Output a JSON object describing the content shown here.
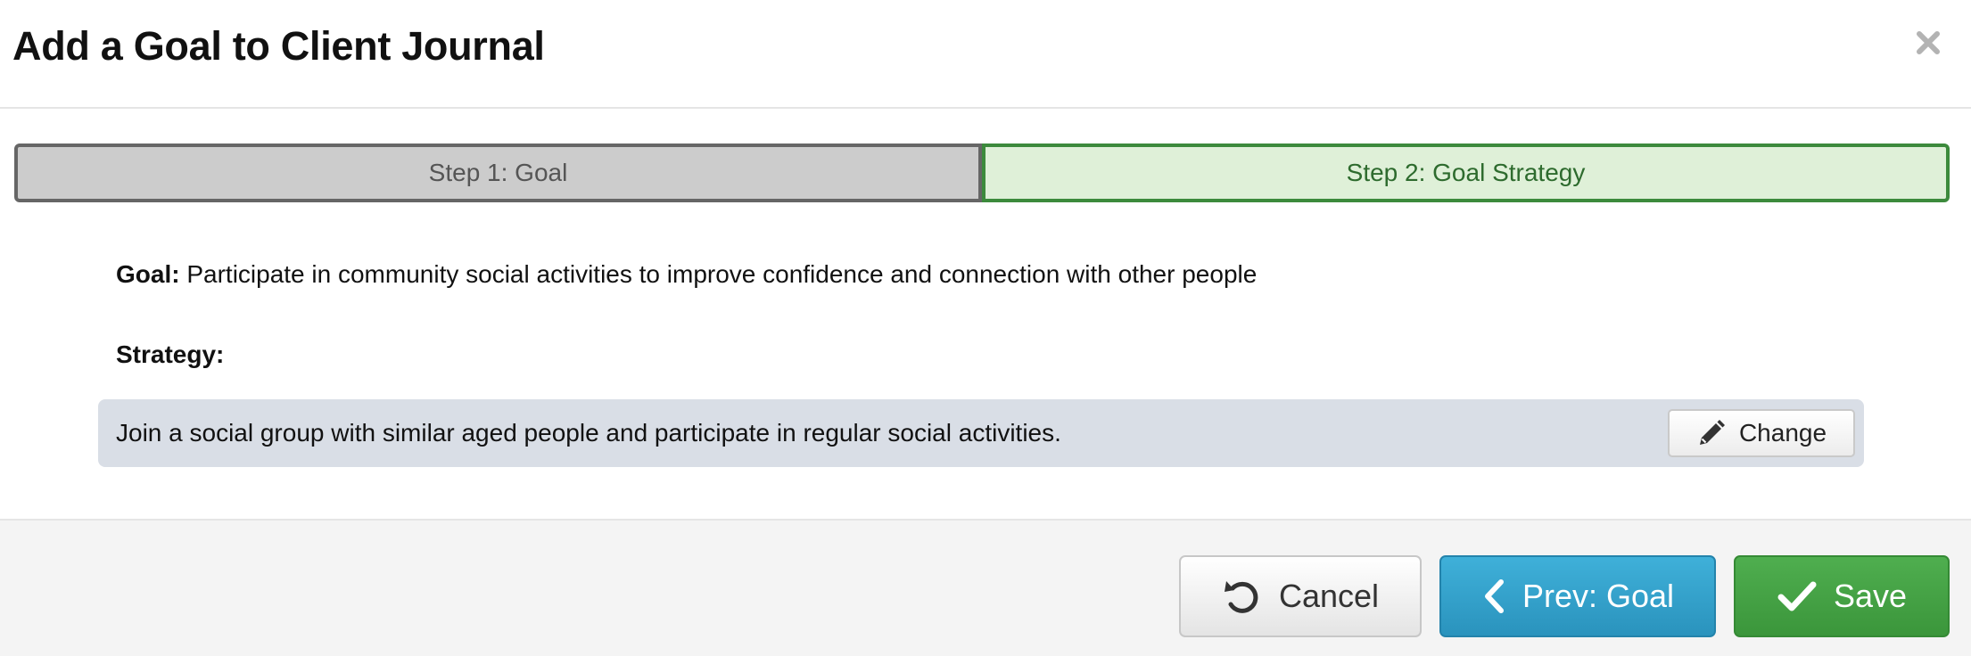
{
  "modal": {
    "title": "Add a Goal to Client Journal",
    "close_icon": "close-icon"
  },
  "steps": [
    {
      "label": "Step 1: Goal",
      "state": "completed",
      "color": "#cccccc"
    },
    {
      "label": "Step 2: Goal Strategy",
      "state": "active",
      "color": "#dff0d8"
    }
  ],
  "goal": {
    "label": "Goal:",
    "text": "Participate in community social activities to improve confidence and connection with other people"
  },
  "strategy": {
    "label": "Strategy:",
    "text": "Join a social group with similar aged people and participate in regular social activities.",
    "change_label": "Change",
    "change_icon": "pencil-icon"
  },
  "footer": {
    "cancel_label": "Cancel",
    "cancel_icon": "undo-icon",
    "prev_label": "Prev: Goal",
    "prev_icon": "chevron-left-icon",
    "save_label": "Save",
    "save_icon": "checkmark-icon"
  },
  "colors": {
    "info": "#31a5d1",
    "success": "#44a144",
    "active_step_border": "#3c8a3c"
  }
}
